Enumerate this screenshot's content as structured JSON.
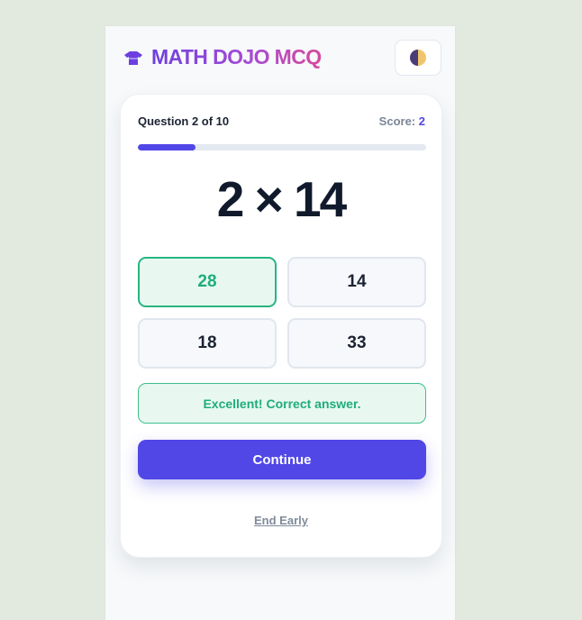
{
  "header": {
    "app_title": "MATH DOJO MCQ",
    "logo_icon": "gi-icon",
    "theme_toggle_icon": "half-moon-theme-icon"
  },
  "quiz": {
    "question_counter": "Question 2 of 10",
    "score_label": "Score:",
    "score_value": "2",
    "progress_fraction": 0.2,
    "question": "2 × 14",
    "answers": [
      {
        "label": "28",
        "state": "correct"
      },
      {
        "label": "14",
        "state": "default"
      },
      {
        "label": "18",
        "state": "default"
      },
      {
        "label": "33",
        "state": "default"
      }
    ],
    "feedback": "Excellent! Correct answer.",
    "continue_label": "Continue",
    "end_early_label": "End Early"
  },
  "colors": {
    "page_background": "#e2e9df",
    "accent": "#5147e6",
    "correct": "#1fad7a",
    "correct_background": "#e8f8f1",
    "text_dark": "#111a2c"
  }
}
